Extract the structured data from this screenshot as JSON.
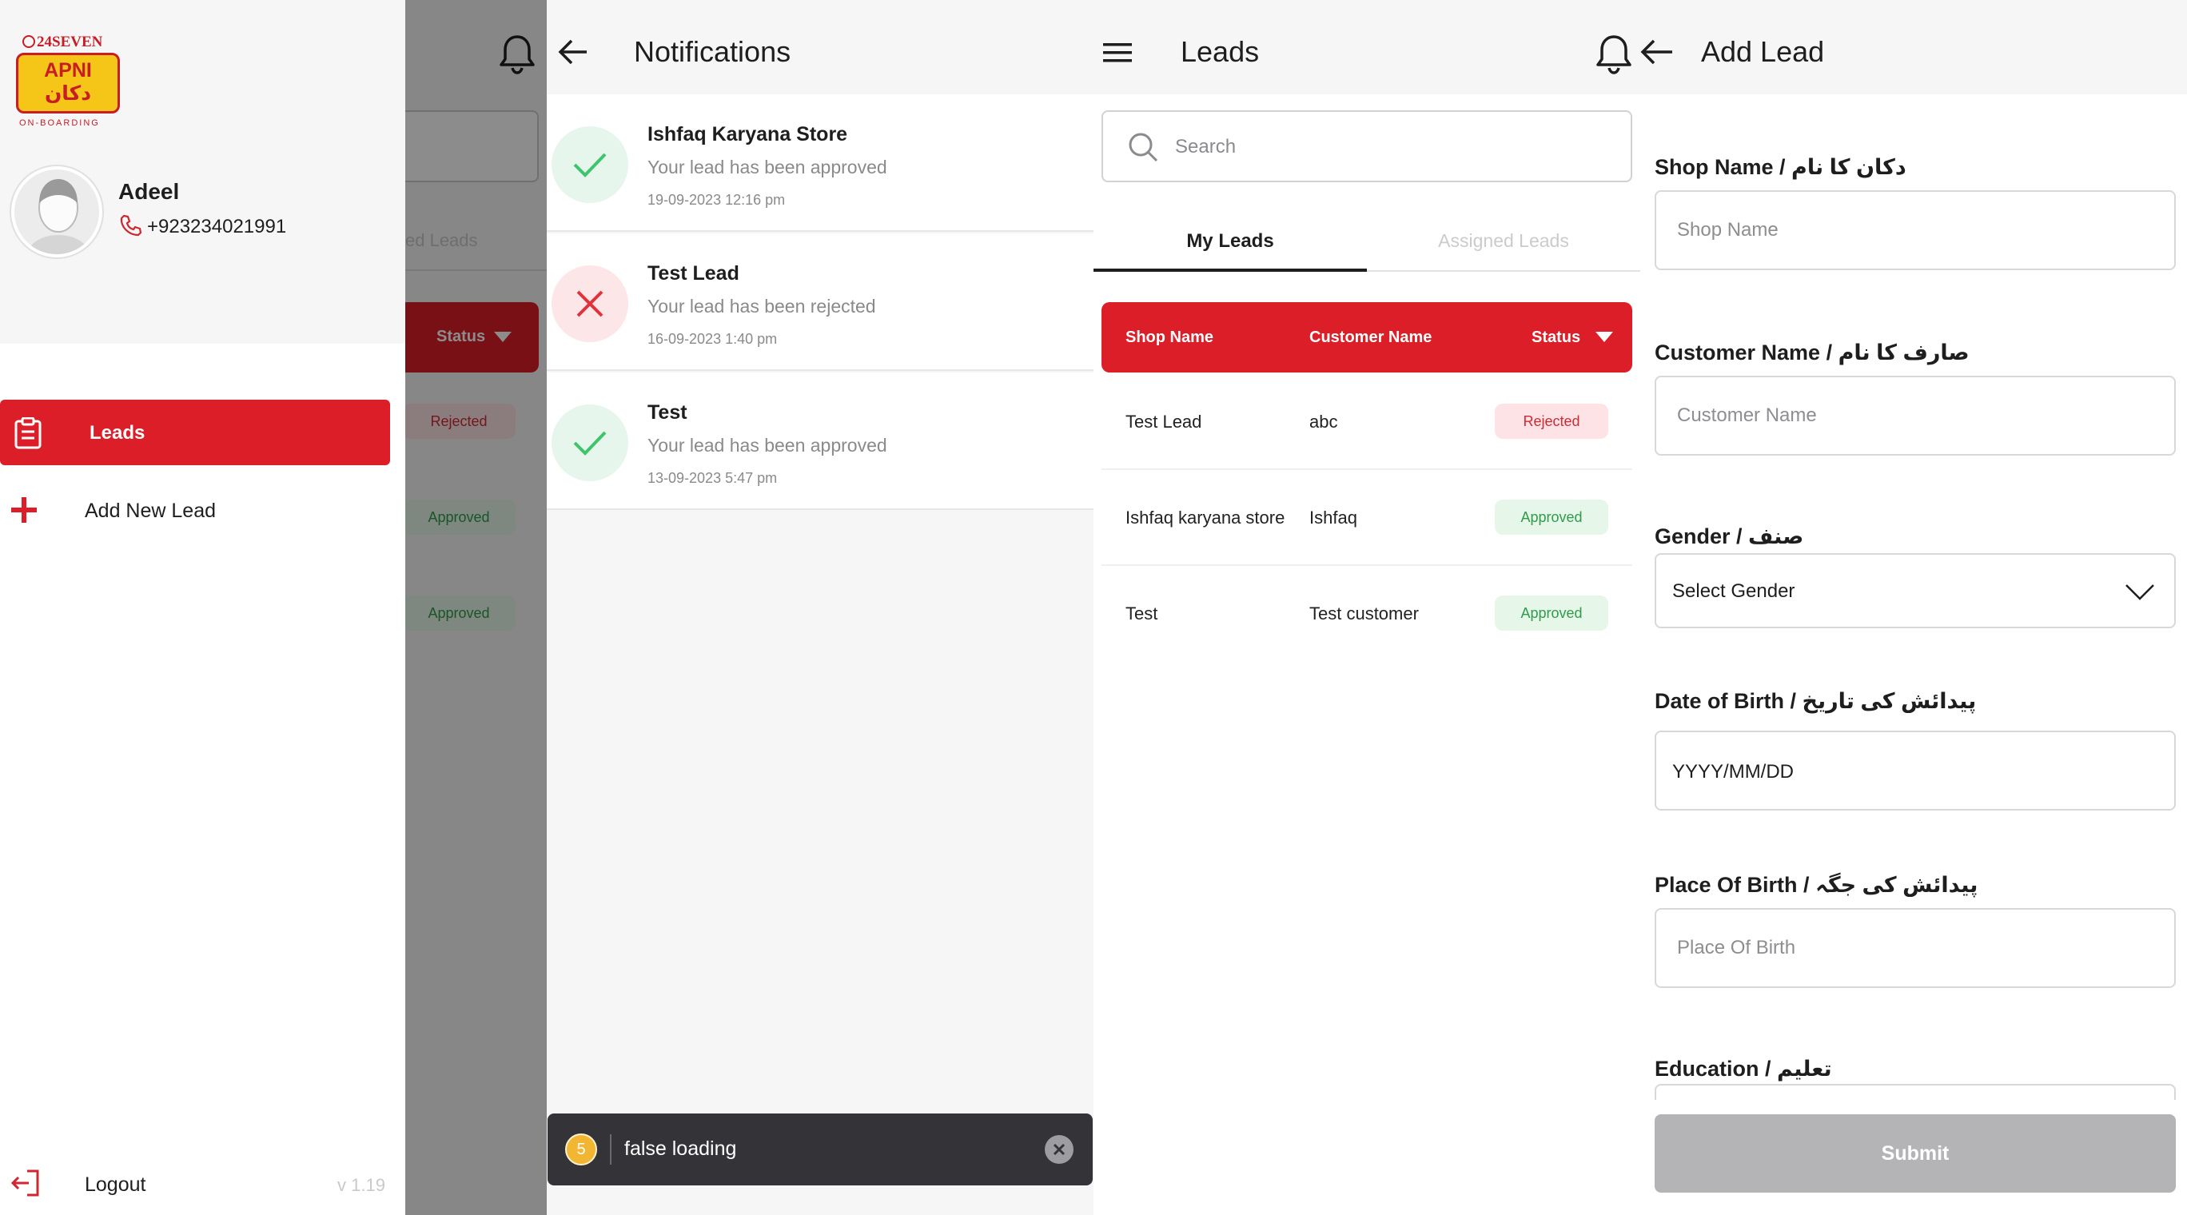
{
  "drawer": {
    "brand_top": "24SEVEN",
    "brand_logo": "APNI دکان",
    "brand_sub": "ON-BOARDING",
    "user_name": "Adeel",
    "user_phone": "+923234021991",
    "menu": [
      {
        "label": "Leads",
        "icon": "clipboard-icon",
        "active": true
      },
      {
        "label": "Add New Lead",
        "icon": "plus-icon",
        "active": false
      }
    ],
    "logout_label": "Logout",
    "version": "v 1.19",
    "accent": "#dc1e28"
  },
  "underlay": {
    "tab_fragment": "ed Leads",
    "status_header": "Status",
    "badges": [
      "Rejected",
      "Approved",
      "Approved"
    ]
  },
  "notifications": {
    "title": "Notifications",
    "items": [
      {
        "title": "Ishfaq Karyana Store",
        "message": "Your lead has been approved",
        "time": "19-09-2023  12:16 pm",
        "status": "approved"
      },
      {
        "title": "Test Lead",
        "message": "Your lead has been rejected",
        "time": "16-09-2023  1:40 pm",
        "status": "rejected"
      },
      {
        "title": "Test",
        "message": "Your lead has been approved",
        "time": "13-09-2023  5:47 pm",
        "status": "approved"
      }
    ],
    "toast": {
      "count": "5",
      "message": "false loading"
    }
  },
  "leads": {
    "title": "Leads",
    "search_placeholder": "Search",
    "tabs": [
      "My Leads",
      "Assigned Leads"
    ],
    "columns": [
      "Shop Name",
      "Customer Name",
      "Status"
    ],
    "rows": [
      {
        "shop": "Test Lead",
        "customer": "abc",
        "status": "Rejected"
      },
      {
        "shop": "Ishfaq karyana store",
        "customer": "Ishfaq",
        "status": "Approved"
      },
      {
        "shop": "Test",
        "customer": "Test customer",
        "status": "Approved"
      }
    ]
  },
  "add_lead": {
    "title": "Add Lead",
    "fields": [
      {
        "label": "Shop Name / دکان کا نام",
        "placeholder": "Shop Name"
      },
      {
        "label": "Customer Name / صارف کا نام",
        "placeholder": "Customer Name"
      },
      {
        "label": "Gender / صنف",
        "value": "Select Gender"
      },
      {
        "label": "Date of Birth /  پیدائش کی تاریخ",
        "value": "YYYY/MM/DD"
      },
      {
        "label": "Place Of Birth / پیدائش کی جگہ",
        "placeholder": "Place Of Birth"
      },
      {
        "label": "Education / تعلیم"
      }
    ],
    "submit_label": "Submit"
  }
}
